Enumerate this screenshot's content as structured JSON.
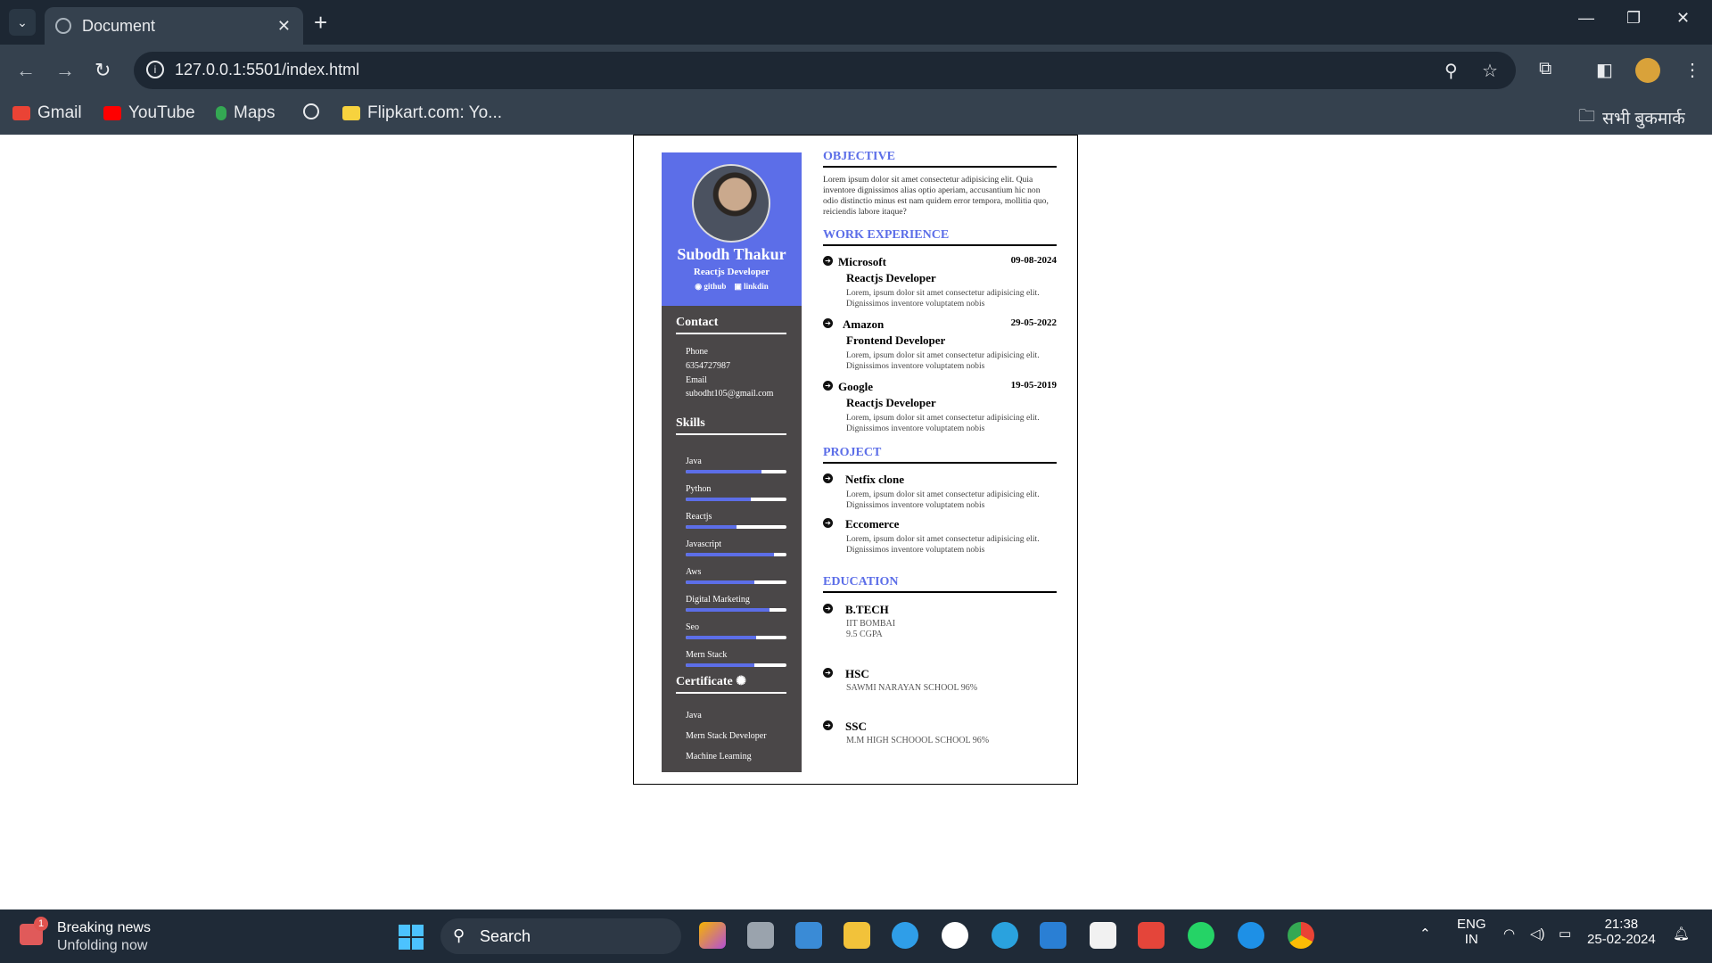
{
  "browser": {
    "tab_title": "Document",
    "url": "127.0.0.1:5501/index.html",
    "bookmarks": [
      "Gmail",
      "YouTube",
      "Maps",
      "Flipkart.com: Yo...",
      "सभी बुकमार्क"
    ],
    "new_tab_symbol": "+",
    "tab_close_symbol": "✕"
  },
  "resume": {
    "name": "Subodh Thakur",
    "role": "Reactjs Developer",
    "links": [
      "github",
      "linkdin"
    ],
    "contact_title": "Contact",
    "phone_label": "Phone",
    "phone": "6354727987",
    "email_label": "Email",
    "email": "subodht105@gmail.com",
    "skills_title": "Skills",
    "skills": [
      {
        "name": "Java",
        "level": 0.75
      },
      {
        "name": "Python",
        "level": 0.65
      },
      {
        "name": "Reactjs",
        "level": 0.5
      },
      {
        "name": "Javascript",
        "level": 0.88
      },
      {
        "name": "Aws",
        "level": 0.68
      },
      {
        "name": "Digital Marketing",
        "level": 0.83
      },
      {
        "name": "Seo",
        "level": 0.7
      },
      {
        "name": "Mern Stack",
        "level": 0.68
      }
    ],
    "certificate_title": "Certificate",
    "certificates": [
      "Java",
      "Mern Stack Developer",
      "Machine Learning"
    ],
    "objective_title": "OBJECTIVE",
    "objective_text": "Lorem ipsum dolor sit amet consectetur adipisicing elit. Quia inventore dignissimos alias optio aperiam, accusantium hic non odio distinctio minus est nam quidem error tempora, mollitia quo, reiciendis labore itaque?",
    "work_title": "WORK EXPERIENCE",
    "work": [
      {
        "company": "Microsoft",
        "date": "09-08-2024",
        "role": "Reactjs Developer",
        "desc": "Lorem, ipsum dolor sit amet consectetur adipisicing elit. Dignissimos inventore voluptatem nobis"
      },
      {
        "company": "Amazon",
        "date": "29-05-2022",
        "role": "Frontend Developer",
        "desc": "Lorem, ipsum dolor sit amet consectetur adipisicing elit. Dignissimos inventore voluptatem nobis"
      },
      {
        "company": "Google",
        "date": "19-05-2019",
        "role": "Reactjs Developer",
        "desc": "Lorem, ipsum dolor sit amet consectetur adipisicing elit. Dignissimos inventore voluptatem nobis"
      }
    ],
    "project_title": "PROJECT",
    "projects": [
      {
        "name": "Netfix clone",
        "desc": "Lorem, ipsum dolor sit amet consectetur adipisicing elit. Dignissimos inventore voluptatem nobis"
      },
      {
        "name": "Eccomerce",
        "desc": "Lorem, ipsum dolor sit amet consectetur adipisicing elit. Dignissimos inventore voluptatem nobis"
      }
    ],
    "education_title": "EDUCATION",
    "education": [
      {
        "degree": "B.TECH",
        "line1": "IIT BOMBAI",
        "line2": "9.5 CGPA"
      },
      {
        "degree": "HSC",
        "line1": "SAWMI NARAYAN SCHOOL 96%",
        "line2": ""
      },
      {
        "degree": "SSC",
        "line1": "M.M HIGH SCHOOOL SCHOOL 96%",
        "line2": ""
      }
    ]
  },
  "taskbar": {
    "news_title": "Breaking news",
    "news_subtitle": "Unfolding now",
    "news_badge": "1",
    "search_label": "Search",
    "lang_line1": "ENG",
    "lang_line2": "IN",
    "time": "21:38",
    "date": "25-02-2024"
  },
  "colors": {
    "accent": "#5c6ee8",
    "sidebar": "#4a4748",
    "chrome": "#35414e",
    "taskbar": "#1f2a37"
  }
}
